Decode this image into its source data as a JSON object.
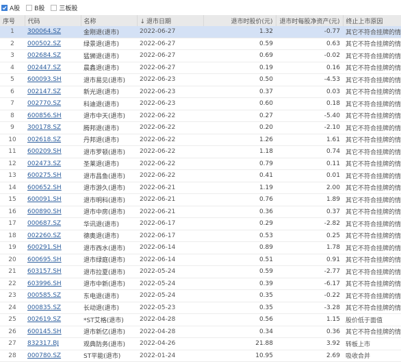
{
  "filters": [
    {
      "label": "A股",
      "checked": true
    },
    {
      "label": "B股",
      "checked": false
    },
    {
      "label": "三板股",
      "checked": false
    }
  ],
  "columns": {
    "index": "序号",
    "code": "代码",
    "name": "名称",
    "sort_arrow": "↓",
    "date": "退市日期",
    "price": "退市时股价(元)",
    "nav": "退市时每股净资产(元)",
    "reason": "终止上市原因"
  },
  "rows": [
    {
      "index": "1",
      "code": "300064.SZ",
      "name": "金刚退(退市)",
      "date": "2022-06-27",
      "price": "1.32",
      "nav": "-0.77",
      "reason": "其它不符合挂牌的情形"
    },
    {
      "index": "2",
      "code": "000502.SZ",
      "name": "绿景退(退市)",
      "date": "2022-06-27",
      "price": "0.59",
      "nav": "0.63",
      "reason": "其它不符合挂牌的情形"
    },
    {
      "index": "3",
      "code": "002684.SZ",
      "name": "猛狮退(退市)",
      "date": "2022-06-27",
      "price": "0.69",
      "nav": "-0.02",
      "reason": "其它不符合挂牌的情形"
    },
    {
      "index": "4",
      "code": "002447.SZ",
      "name": "晨鑫退(退市)",
      "date": "2022-06-27",
      "price": "0.19",
      "nav": "0.16",
      "reason": "其它不符合挂牌的情形"
    },
    {
      "index": "5",
      "code": "600093.SH",
      "name": "退市易见(退市)",
      "date": "2022-06-23",
      "price": "0.50",
      "nav": "-4.53",
      "reason": "其它不符合挂牌的情形"
    },
    {
      "index": "6",
      "code": "002147.SZ",
      "name": "新光退(退市)",
      "date": "2022-06-23",
      "price": "0.37",
      "nav": "0.03",
      "reason": "其它不符合挂牌的情形"
    },
    {
      "index": "7",
      "code": "002770.SZ",
      "name": "科迪退(退市)",
      "date": "2022-06-23",
      "price": "0.60",
      "nav": "0.18",
      "reason": "其它不符合挂牌的情形"
    },
    {
      "index": "8",
      "code": "600856.SH",
      "name": "退市中天(退市)",
      "date": "2022-06-22",
      "price": "0.27",
      "nav": "-5.40",
      "reason": "其它不符合挂牌的情形"
    },
    {
      "index": "9",
      "code": "300178.SZ",
      "name": "腾邦退(退市)",
      "date": "2022-06-22",
      "price": "0.20",
      "nav": "-2.10",
      "reason": "其它不符合挂牌的情形"
    },
    {
      "index": "10",
      "code": "002618.SZ",
      "name": "丹邦退(退市)",
      "date": "2022-06-22",
      "price": "1.26",
      "nav": "1.61",
      "reason": "其它不符合挂牌的情形"
    },
    {
      "index": "11",
      "code": "600209.SH",
      "name": "退市罗顿(退市)",
      "date": "2022-06-22",
      "price": "1.18",
      "nav": "0.74",
      "reason": "其它不符合挂牌的情形"
    },
    {
      "index": "12",
      "code": "002473.SZ",
      "name": "圣莱退(退市)",
      "date": "2022-06-22",
      "price": "0.79",
      "nav": "0.11",
      "reason": "其它不符合挂牌的情形"
    },
    {
      "index": "13",
      "code": "600275.SH",
      "name": "退市昌鱼(退市)",
      "date": "2022-06-22",
      "price": "0.41",
      "nav": "0.01",
      "reason": "其它不符合挂牌的情形"
    },
    {
      "index": "14",
      "code": "600652.SH",
      "name": "退市游久(退市)",
      "date": "2022-06-21",
      "price": "1.19",
      "nav": "2.00",
      "reason": "其它不符合挂牌的情形"
    },
    {
      "index": "15",
      "code": "600091.SH",
      "name": "退市明科(退市)",
      "date": "2022-06-21",
      "price": "0.76",
      "nav": "1.89",
      "reason": "其它不符合挂牌的情形"
    },
    {
      "index": "16",
      "code": "600890.SH",
      "name": "退市中房(退市)",
      "date": "2022-06-21",
      "price": "0.36",
      "nav": "0.37",
      "reason": "其它不符合挂牌的情形"
    },
    {
      "index": "17",
      "code": "000687.SZ",
      "name": "华讯退(退市)",
      "date": "2022-06-17",
      "price": "0.29",
      "nav": "-2.82",
      "reason": "其它不符合挂牌的情形"
    },
    {
      "index": "18",
      "code": "002260.SZ",
      "name": "德奥退(退市)",
      "date": "2022-06-17",
      "price": "0.53",
      "nav": "0.25",
      "reason": "其它不符合挂牌的情形"
    },
    {
      "index": "19",
      "code": "600291.SH",
      "name": "退市西水(退市)",
      "date": "2022-06-14",
      "price": "0.89",
      "nav": "1.78",
      "reason": "其它不符合挂牌的情形"
    },
    {
      "index": "20",
      "code": "600695.SH",
      "name": "退市绿庭(退市)",
      "date": "2022-06-14",
      "price": "0.51",
      "nav": "0.91",
      "reason": "其它不符合挂牌的情形"
    },
    {
      "index": "21",
      "code": "603157.SH",
      "name": "退市拉夏(退市)",
      "date": "2022-05-24",
      "price": "0.59",
      "nav": "-2.77",
      "reason": "其它不符合挂牌的情形"
    },
    {
      "index": "22",
      "code": "603996.SH",
      "name": "退市中新(退市)",
      "date": "2022-05-24",
      "price": "0.39",
      "nav": "-6.17",
      "reason": "其它不符合挂牌的情形"
    },
    {
      "index": "23",
      "code": "000585.SZ",
      "name": "东电退(退市)",
      "date": "2022-05-24",
      "price": "0.35",
      "nav": "-0.22",
      "reason": "其它不符合挂牌的情形"
    },
    {
      "index": "24",
      "code": "000835.SZ",
      "name": "长动退(退市)",
      "date": "2022-05-23",
      "price": "0.35",
      "nav": "-3.28",
      "reason": "其它不符合挂牌的情形"
    },
    {
      "index": "25",
      "code": "002619.SZ",
      "name": "*ST艾格(退市)",
      "date": "2022-04-28",
      "price": "0.56",
      "nav": "1.15",
      "reason": "股价低于面值"
    },
    {
      "index": "26",
      "code": "600145.SH",
      "name": "退市新亿(退市)",
      "date": "2022-04-28",
      "price": "0.34",
      "nav": "0.36",
      "reason": "其它不符合挂牌的情形"
    },
    {
      "index": "27",
      "code": "832317.BJ",
      "name": "观典防务(退市)",
      "date": "2022-04-26",
      "price": "21.88",
      "nav": "3.92",
      "reason": "转板上市"
    },
    {
      "index": "28",
      "code": "000780.SZ",
      "name": "ST平能(退市)",
      "date": "2022-01-24",
      "price": "10.95",
      "nav": "2.69",
      "reason": "吸收合并"
    }
  ],
  "selected_row": 1,
  "colors": {
    "accent": "#3c7fd6",
    "selected_row": "#d4e1f5",
    "header_bg": "#e9e9e9",
    "link": "#2c5e9e"
  }
}
